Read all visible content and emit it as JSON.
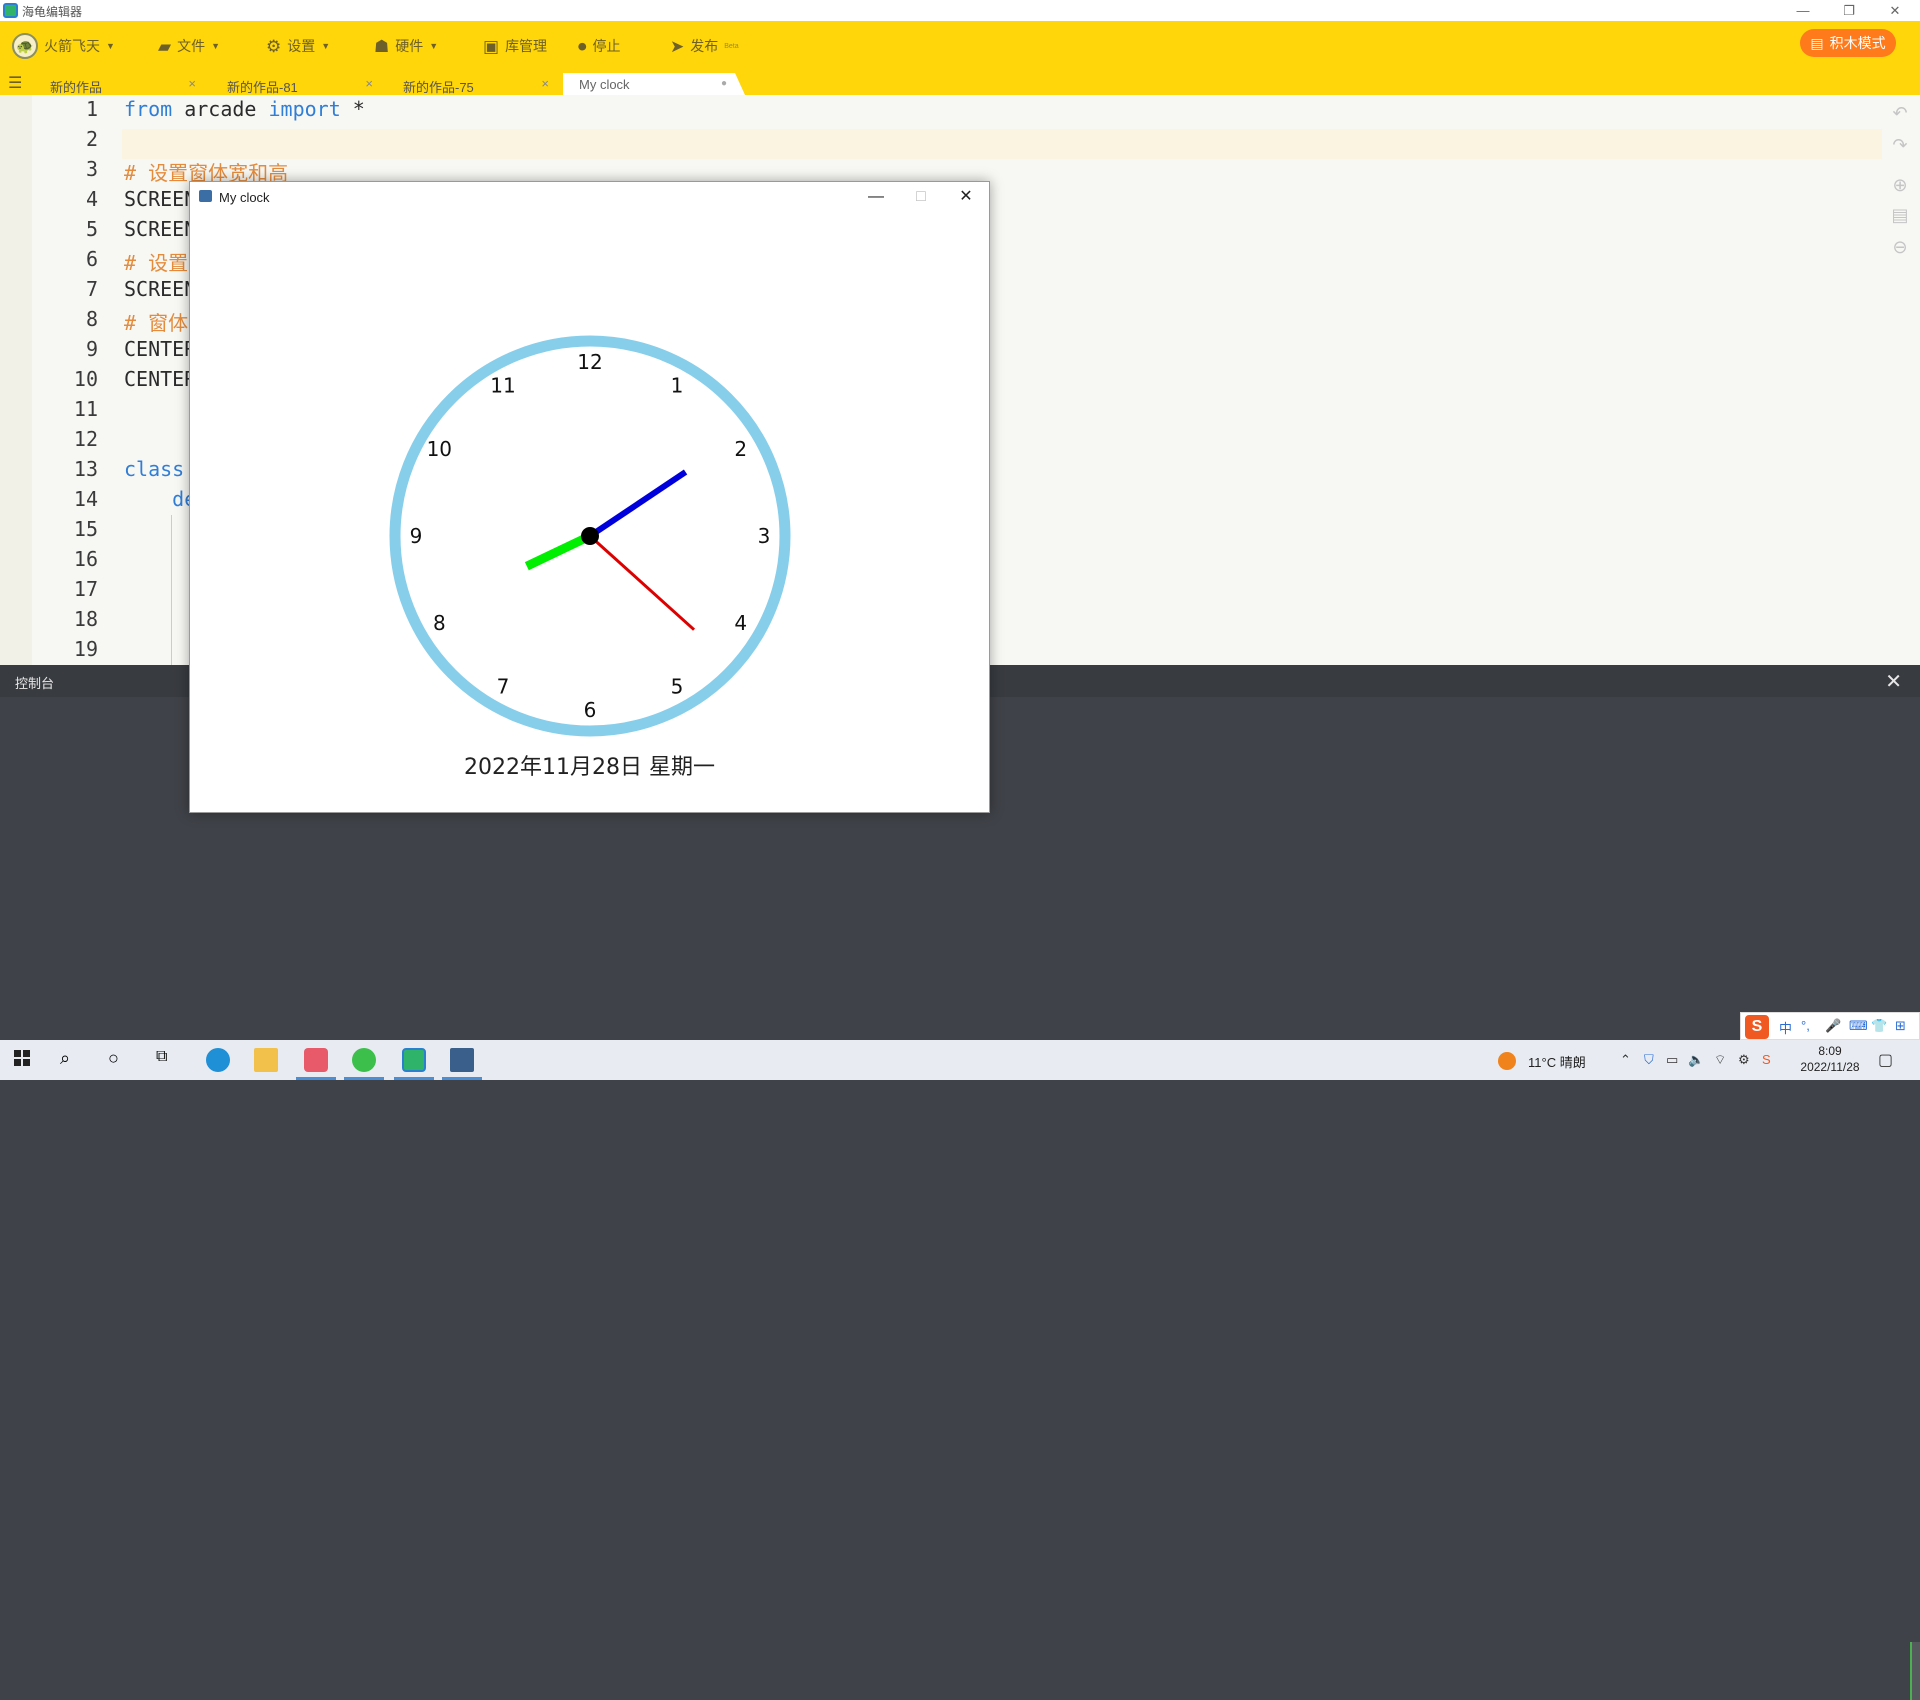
{
  "window": {
    "title": "海龟编辑器",
    "controls": {
      "minimize": "—",
      "restore": "❐",
      "close": "✕"
    }
  },
  "toolbar": {
    "user": {
      "label": "火箭飞天",
      "icon": "user-avatar-icon"
    },
    "items": [
      {
        "label": "文件",
        "icon": "folder-icon",
        "dropdown": true
      },
      {
        "label": "设置",
        "icon": "gear-icon",
        "dropdown": true
      },
      {
        "label": "硬件",
        "icon": "hardware-icon",
        "dropdown": true
      },
      {
        "label": "库管理",
        "icon": "library-icon",
        "dropdown": false
      },
      {
        "label": "停止",
        "icon": "stop-icon",
        "dropdown": false
      },
      {
        "label": "发布",
        "icon": "send-icon",
        "dropdown": false,
        "badge": "Beta"
      }
    ],
    "block_mode": "积木模式"
  },
  "tabs": [
    {
      "label": "新的作品",
      "close": "×",
      "active": false
    },
    {
      "label": "新的作品-81",
      "close": "×",
      "active": false
    },
    {
      "label": "新的作品-75",
      "close": "×",
      "active": false
    },
    {
      "label": "My clock",
      "close": "●",
      "active": true
    }
  ],
  "editor": {
    "lines": [
      {
        "n": "1",
        "segments": [
          {
            "t": "from",
            "c": "kw"
          },
          {
            "t": " arcade ",
            "c": ""
          },
          {
            "t": "import",
            "c": "kw"
          },
          {
            "t": " *",
            "c": ""
          }
        ]
      },
      {
        "n": "2",
        "segments": []
      },
      {
        "n": "3",
        "segments": [
          {
            "t": "# 设置窗体宽和高",
            "c": "cm"
          }
        ]
      },
      {
        "n": "4",
        "segments": [
          {
            "t": "SCREEN",
            "c": ""
          }
        ]
      },
      {
        "n": "5",
        "segments": [
          {
            "t": "SCREEN",
            "c": ""
          }
        ]
      },
      {
        "n": "6",
        "segments": [
          {
            "t": "# 设置",
            "c": "cm"
          }
        ]
      },
      {
        "n": "7",
        "segments": [
          {
            "t": "SCREEN",
            "c": ""
          }
        ]
      },
      {
        "n": "8",
        "segments": [
          {
            "t": "# 窗体",
            "c": "cm"
          }
        ]
      },
      {
        "n": "9",
        "segments": [
          {
            "t": "CENTER",
            "c": ""
          }
        ]
      },
      {
        "n": "10",
        "segments": [
          {
            "t": "CENTER",
            "c": ""
          }
        ]
      },
      {
        "n": "11",
        "segments": []
      },
      {
        "n": "12",
        "segments": []
      },
      {
        "n": "13",
        "segments": [
          {
            "t": "class",
            "c": "kw"
          }
        ]
      },
      {
        "n": "14",
        "segments": [
          {
            "t": "    de",
            "c": "kw"
          }
        ]
      },
      {
        "n": "15",
        "segments": []
      },
      {
        "n": "16",
        "segments": []
      },
      {
        "n": "17",
        "segments": []
      },
      {
        "n": "18",
        "segments": []
      },
      {
        "n": "19",
        "segments": []
      }
    ],
    "side_tools": [
      "undo-icon",
      "redo-icon",
      "zoom-in-icon",
      "format-icon",
      "zoom-out-icon"
    ],
    "stop_label": "停止"
  },
  "console": {
    "title": "控制台",
    "close": "✕"
  },
  "clock_window": {
    "title": "My clock",
    "controls": {
      "minimize": "—",
      "maximize": "□",
      "close": "✕"
    },
    "numbers": [
      "12",
      "1",
      "2",
      "3",
      "4",
      "5",
      "6",
      "7",
      "8",
      "9",
      "10",
      "11"
    ],
    "time": {
      "hour": 8,
      "minute": 9,
      "second": 22
    },
    "colors": {
      "ring": "#87ceeb",
      "hour": "#00ee00",
      "minute": "#0000dd",
      "second": "#dd0000",
      "center": "#000000"
    },
    "date": "2022年11月28日  星期一"
  },
  "taskbar": {
    "apps": [
      "windows-start-icon",
      "search-icon",
      "cortana-icon",
      "task-view-icon",
      "edge-icon",
      "file-explorer-icon",
      "photo-app-icon",
      "wechat-icon",
      "turtle-editor-icon",
      "python-window-icon"
    ],
    "weather": "11°C 晴朗",
    "time": "8:09",
    "date": "2022/11/28"
  },
  "ime": {
    "labels": [
      "中",
      "°,",
      "🎤",
      "⌨",
      "👕",
      "⊞"
    ]
  }
}
